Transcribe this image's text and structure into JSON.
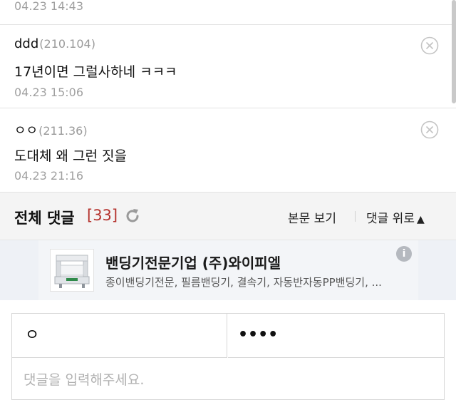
{
  "comments": [
    {
      "author": "",
      "ip": "",
      "body": "",
      "time": "04.23 14:43"
    },
    {
      "author": "ddd",
      "ip": "(210.104)",
      "body": "17년이면 그럴사하네 ㅋㅋㅋ",
      "time": "04.23 15:06"
    },
    {
      "author": "ㅇㅇ",
      "ip": "(211.36)",
      "body": "도대체 왜 그런 짓을",
      "time": "04.23 21:16"
    }
  ],
  "comment_bar": {
    "title": "전체 댓글",
    "count": "[33]",
    "view_body": "본문 보기",
    "to_top": "댓글 위로",
    "to_top_glyph": "▲"
  },
  "ad": {
    "title": "밴딩기전문기업 (주)와이피엘",
    "desc": "종이밴딩기전문, 필름밴딩기, 결속기, 자동반자동PP밴딩기, ...",
    "info": "i"
  },
  "form": {
    "name_value": "ㅇ",
    "password_value": "••••",
    "textarea_placeholder": "댓글을 입력해주세요."
  },
  "colors": {
    "count": "#b5322d",
    "ip": "#9a9a9a",
    "time": "#a0a0a0"
  }
}
